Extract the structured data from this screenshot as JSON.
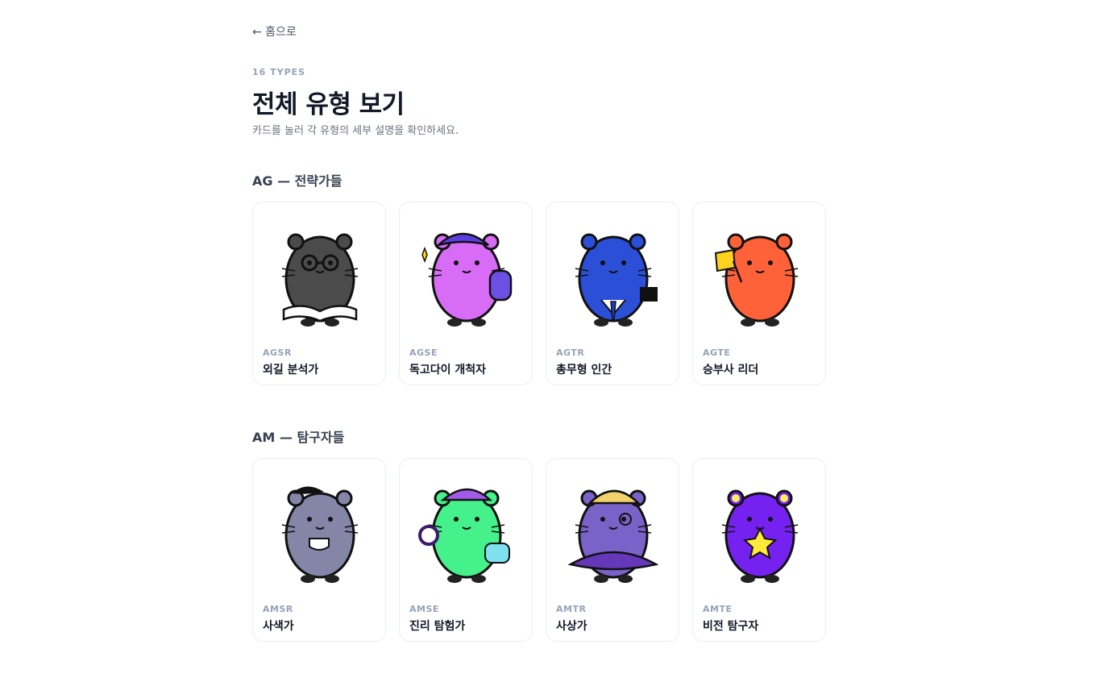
{
  "nav": {
    "back_label": "← 홈으로"
  },
  "header": {
    "eyebrow": "16 TYPES",
    "title": "전체 유형 보기",
    "subtitle": "카드를 눌러 각 유형의 세부 설명을 확인하세요."
  },
  "groups": [
    {
      "heading": "AG — 전략가들",
      "cards": [
        {
          "code": "AGSR",
          "name": "외길 분석가",
          "color": "#4b4b4b",
          "icon": "glasses-book-hamster"
        },
        {
          "code": "AGSE",
          "name": "독고다이 개척자",
          "color": "#d86cf7",
          "icon": "backpack-hamster"
        },
        {
          "code": "AGTR",
          "name": "총무형 인간",
          "color": "#2b4fd6",
          "icon": "suit-hamster"
        },
        {
          "code": "AGTE",
          "name": "승부사 리더",
          "color": "#ff6138",
          "icon": "flag-hamster"
        }
      ]
    },
    {
      "heading": "AM — 탐구자들",
      "cards": [
        {
          "code": "AMSR",
          "name": "사색가",
          "color": "#8585a8",
          "icon": "tea-hamster"
        },
        {
          "code": "AMSE",
          "name": "진리 탐험가",
          "color": "#44f18a",
          "icon": "magnifier-hamster"
        },
        {
          "code": "AMTR",
          "name": "사상가",
          "color": "#7b62c9",
          "icon": "cape-hamster"
        },
        {
          "code": "AMTE",
          "name": "비전 탐구자",
          "color": "#7522f0",
          "icon": "star-hamster"
        }
      ]
    }
  ]
}
